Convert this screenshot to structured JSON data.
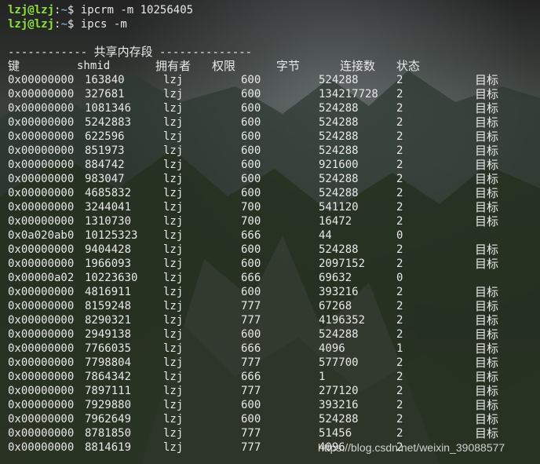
{
  "prompt": {
    "user": "lzj@lzj",
    "path": "~",
    "symbol": "$"
  },
  "commands": [
    "ipcrm -m 10256405",
    "ipcs -m"
  ],
  "section_title": {
    "dashes_left": "------------",
    "text": "共享内存段",
    "dashes_right": "--------------"
  },
  "headers": {
    "key": "键",
    "shmid": "shmid",
    "owner": "拥有者",
    "perms": "权限",
    "bytes": "字节",
    "nattch": "连接数",
    "status": "状态"
  },
  "rows": [
    {
      "key": "0x00000000",
      "shmid": "163840",
      "owner": "lzj",
      "perms": "600",
      "bytes": "524288",
      "nattch": "2",
      "status": "目标"
    },
    {
      "key": "0x00000000",
      "shmid": "327681",
      "owner": "lzj",
      "perms": "600",
      "bytes": "134217728",
      "nattch": "2",
      "status": "目标"
    },
    {
      "key": "0x00000000",
      "shmid": "1081346",
      "owner": "lzj",
      "perms": "600",
      "bytes": "524288",
      "nattch": "2",
      "status": "目标"
    },
    {
      "key": "0x00000000",
      "shmid": "5242883",
      "owner": "lzj",
      "perms": "600",
      "bytes": "524288",
      "nattch": "2",
      "status": "目标"
    },
    {
      "key": "0x00000000",
      "shmid": "622596",
      "owner": "lzj",
      "perms": "600",
      "bytes": "524288",
      "nattch": "2",
      "status": "目标"
    },
    {
      "key": "0x00000000",
      "shmid": "851973",
      "owner": "lzj",
      "perms": "600",
      "bytes": "524288",
      "nattch": "2",
      "status": "目标"
    },
    {
      "key": "0x00000000",
      "shmid": "884742",
      "owner": "lzj",
      "perms": "600",
      "bytes": "921600",
      "nattch": "2",
      "status": "目标"
    },
    {
      "key": "0x00000000",
      "shmid": "983047",
      "owner": "lzj",
      "perms": "600",
      "bytes": "524288",
      "nattch": "2",
      "status": "目标"
    },
    {
      "key": "0x00000000",
      "shmid": "4685832",
      "owner": "lzj",
      "perms": "600",
      "bytes": "524288",
      "nattch": "2",
      "status": "目标"
    },
    {
      "key": "0x00000000",
      "shmid": "3244041",
      "owner": "lzj",
      "perms": "700",
      "bytes": "541120",
      "nattch": "2",
      "status": "目标"
    },
    {
      "key": "0x00000000",
      "shmid": "1310730",
      "owner": "lzj",
      "perms": "700",
      "bytes": "16472",
      "nattch": "2",
      "status": "目标"
    },
    {
      "key": "0x0a020ab0",
      "shmid": "10125323",
      "owner": "lzj",
      "perms": "666",
      "bytes": "44",
      "nattch": "0",
      "status": ""
    },
    {
      "key": "0x00000000",
      "shmid": "9404428",
      "owner": "lzj",
      "perms": "600",
      "bytes": "524288",
      "nattch": "2",
      "status": "目标"
    },
    {
      "key": "0x00000000",
      "shmid": "1966093",
      "owner": "lzj",
      "perms": "600",
      "bytes": "2097152",
      "nattch": "2",
      "status": "目标"
    },
    {
      "key": "0x00000a02",
      "shmid": "10223630",
      "owner": "lzj",
      "perms": "666",
      "bytes": "69632",
      "nattch": "0",
      "status": ""
    },
    {
      "key": "0x00000000",
      "shmid": "4816911",
      "owner": "lzj",
      "perms": "600",
      "bytes": "393216",
      "nattch": "2",
      "status": "目标"
    },
    {
      "key": "0x00000000",
      "shmid": "8159248",
      "owner": "lzj",
      "perms": "777",
      "bytes": "67268",
      "nattch": "2",
      "status": "目标"
    },
    {
      "key": "0x00000000",
      "shmid": "8290321",
      "owner": "lzj",
      "perms": "777",
      "bytes": "4196352",
      "nattch": "2",
      "status": "目标"
    },
    {
      "key": "0x00000000",
      "shmid": "2949138",
      "owner": "lzj",
      "perms": "600",
      "bytes": "524288",
      "nattch": "2",
      "status": "目标"
    },
    {
      "key": "0x00000000",
      "shmid": "7766035",
      "owner": "lzj",
      "perms": "666",
      "bytes": "4096",
      "nattch": "1",
      "status": "目标"
    },
    {
      "key": "0x00000000",
      "shmid": "7798804",
      "owner": "lzj",
      "perms": "777",
      "bytes": "577700",
      "nattch": "2",
      "status": "目标"
    },
    {
      "key": "0x00000000",
      "shmid": "7864342",
      "owner": "lzj",
      "perms": "666",
      "bytes": "1",
      "nattch": "2",
      "status": "目标"
    },
    {
      "key": "0x00000000",
      "shmid": "7897111",
      "owner": "lzj",
      "perms": "777",
      "bytes": "277120",
      "nattch": "2",
      "status": "目标"
    },
    {
      "key": "0x00000000",
      "shmid": "7929880",
      "owner": "lzj",
      "perms": "600",
      "bytes": "393216",
      "nattch": "2",
      "status": "目标"
    },
    {
      "key": "0x00000000",
      "shmid": "7962649",
      "owner": "lzj",
      "perms": "600",
      "bytes": "524288",
      "nattch": "2",
      "status": "目标"
    },
    {
      "key": "0x00000000",
      "shmid": "8781850",
      "owner": "lzj",
      "perms": "777",
      "bytes": "51456",
      "nattch": "2",
      "status": "目标"
    },
    {
      "key": "0x00000000",
      "shmid": "8814619",
      "owner": "lzj",
      "perms": "777",
      "bytes": "4096",
      "nattch": "2",
      "status": ""
    }
  ],
  "watermark": "https://blog.csdn.net/weixin_39088577",
  "colors": {
    "user": "#8ae234",
    "path": "#729fcf",
    "text": "#e8e8e8"
  }
}
